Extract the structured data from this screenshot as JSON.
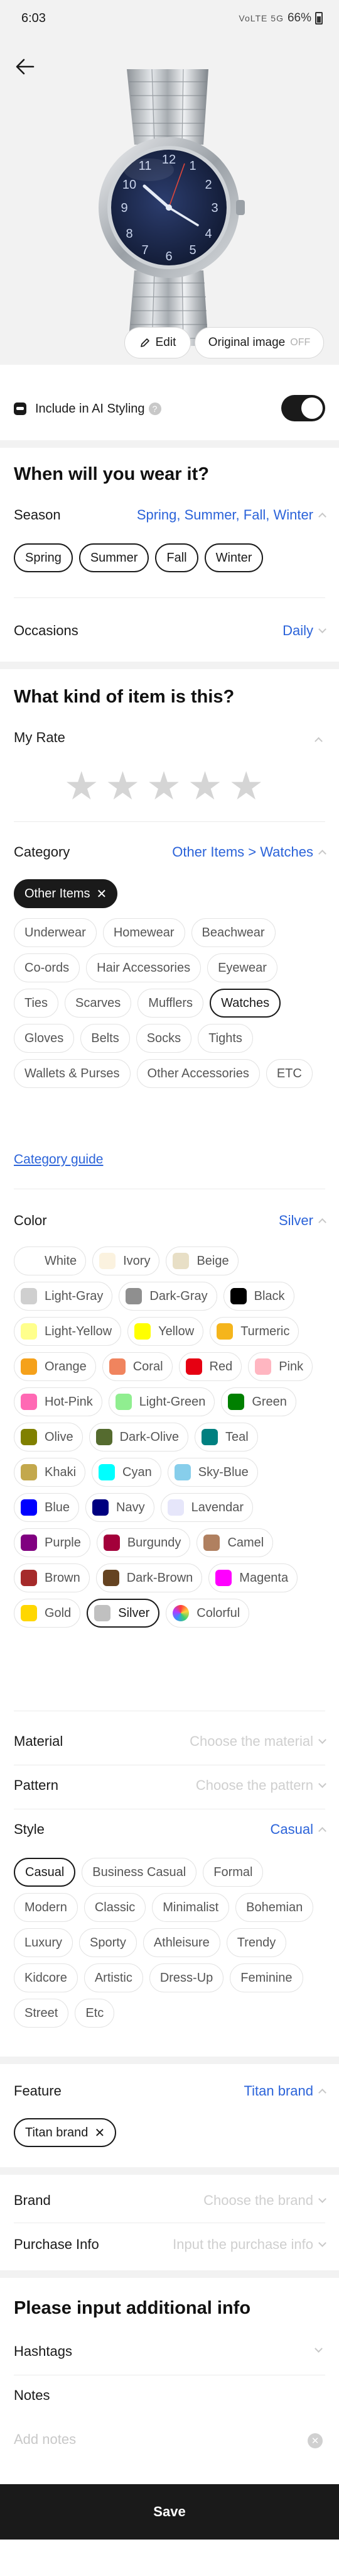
{
  "status_bar": {
    "time": "6:03",
    "icons": "VoLTE 5G",
    "battery": "66%"
  },
  "hero": {
    "edit_label": "Edit",
    "original_image_label": "Original image",
    "original_image_state": "OFF"
  },
  "ai_styling": {
    "label": "Include in AI Styling",
    "help": "?",
    "enabled": true
  },
  "wear": {
    "heading": "When will you wear it?",
    "season_label": "Season",
    "season_value": "Spring, Summer, Fall, Winter",
    "season_chips": [
      "Spring",
      "Summer",
      "Fall",
      "Winter"
    ],
    "occasions_label": "Occasions",
    "occasions_value": "Daily"
  },
  "item": {
    "heading": "What kind of item is this?",
    "rate_label": "My Rate",
    "rating": 0,
    "category_label": "Category",
    "category_value": "Other Items > Watches",
    "category_selected_chip": "Other Items",
    "subcategories": [
      "Underwear",
      "Homewear",
      "Beachwear",
      "Co-ords",
      "Hair Accessories",
      "Eyewear",
      "Ties",
      "Scarves",
      "Mufflers",
      "Watches",
      "Gloves",
      "Belts",
      "Socks",
      "Tights",
      "Wallets & Purses",
      "Other Accessories",
      "ETC"
    ],
    "subcategory_selected": "Watches",
    "category_guide": "Category guide"
  },
  "color": {
    "label": "Color",
    "value": "Silver",
    "selected": "Silver",
    "options": [
      {
        "name": "White",
        "hex": "#ffffff"
      },
      {
        "name": "Ivory",
        "hex": "#fbf2df"
      },
      {
        "name": "Beige",
        "hex": "#e8dfc6"
      },
      {
        "name": "Light-Gray",
        "hex": "#cfcfcf"
      },
      {
        "name": "Dark-Gray",
        "hex": "#8f8f8f"
      },
      {
        "name": "Black",
        "hex": "#000000"
      },
      {
        "name": "Light-Yellow",
        "hex": "#ffff8c"
      },
      {
        "name": "Yellow",
        "hex": "#ffff00"
      },
      {
        "name": "Turmeric",
        "hex": "#f5b51c"
      },
      {
        "name": "Orange",
        "hex": "#f5a11b"
      },
      {
        "name": "Coral",
        "hex": "#f0845e"
      },
      {
        "name": "Red",
        "hex": "#e60012"
      },
      {
        "name": "Pink",
        "hex": "#ffb6c1"
      },
      {
        "name": "Hot-Pink",
        "hex": "#ff69b4"
      },
      {
        "name": "Light-Green",
        "hex": "#90ee90"
      },
      {
        "name": "Green",
        "hex": "#008000"
      },
      {
        "name": "Olive",
        "hex": "#808000"
      },
      {
        "name": "Dark-Olive",
        "hex": "#556b2f"
      },
      {
        "name": "Teal",
        "hex": "#008080"
      },
      {
        "name": "Khaki",
        "hex": "#c3a84c"
      },
      {
        "name": "Cyan",
        "hex": "#00ffff"
      },
      {
        "name": "Sky-Blue",
        "hex": "#87ceeb"
      },
      {
        "name": "Blue",
        "hex": "#0000ff"
      },
      {
        "name": "Navy",
        "hex": "#000080"
      },
      {
        "name": "Lavendar",
        "hex": "#e6e6fa"
      },
      {
        "name": "Purple",
        "hex": "#800080"
      },
      {
        "name": "Burgundy",
        "hex": "#a3003a"
      },
      {
        "name": "Camel",
        "hex": "#b08060"
      },
      {
        "name": "Brown",
        "hex": "#a52a2a"
      },
      {
        "name": "Dark-Brown",
        "hex": "#654321"
      },
      {
        "name": "Magenta",
        "hex": "#ff00ff"
      },
      {
        "name": "Gold",
        "hex": "#ffd700"
      },
      {
        "name": "Silver",
        "hex": "#c0c0c0"
      },
      {
        "name": "Colorful",
        "hex": "multi"
      }
    ]
  },
  "material": {
    "label": "Material",
    "placeholder": "Choose the material"
  },
  "pattern": {
    "label": "Pattern",
    "placeholder": "Choose the pattern"
  },
  "style": {
    "label": "Style",
    "value": "Casual",
    "options": [
      "Casual",
      "Business Casual",
      "Formal",
      "Modern",
      "Classic",
      "Minimalist",
      "Bohemian",
      "Luxury",
      "Sporty",
      "Athleisure",
      "Trendy",
      "Kidcore",
      "Artistic",
      "Dress-Up",
      "Feminine",
      "Street",
      "Etc"
    ],
    "selected": "Casual"
  },
  "feature": {
    "label": "Feature",
    "value": "Titan brand",
    "chip": "Titan brand"
  },
  "brand": {
    "label": "Brand",
    "placeholder": "Choose the brand"
  },
  "purchase": {
    "label": "Purchase Info",
    "placeholder": "Input the purchase info"
  },
  "additional": {
    "heading": "Please input additional info",
    "hashtags_label": "Hashtags",
    "notes_label": "Notes",
    "notes_placeholder": "Add notes"
  },
  "save_label": "Save"
}
